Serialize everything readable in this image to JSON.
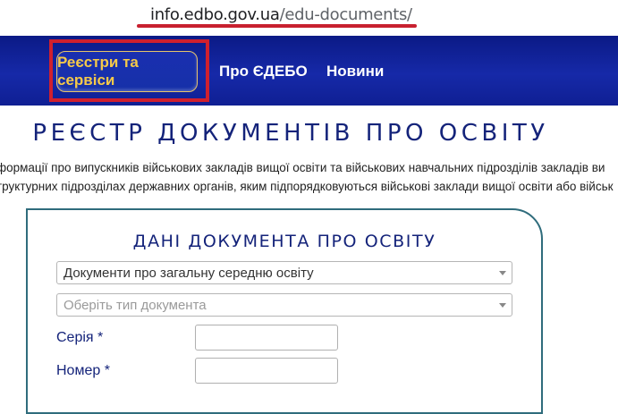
{
  "browser": {
    "url_domain": "info.edbo.gov.ua",
    "url_path": "/edu-documents/"
  },
  "nav": {
    "active_label": "Реєстри та сервіси",
    "items": [
      {
        "label": "Про ЄДЕБО"
      },
      {
        "label": "Новини"
      }
    ]
  },
  "page": {
    "title": "РЕЄСТР ДОКУМЕНТІВ ПРО ОСВІТУ",
    "intro_line1": "формації про випускників військових закладів вищої освіти та військових навчальних підрозділів закладів ви",
    "intro_line2": "труктурних підрозділах державних органів, яким підпорядковуються військові заклади вищої освіти або військ"
  },
  "form": {
    "title": "ДАНІ ДОКУМЕНТА ПРО ОСВІТУ",
    "document_category_value": "Документи про загальну середню освіту",
    "document_type_placeholder": "Оберіть тип документа",
    "series_label": "Серія *",
    "series_value": "",
    "number_label": "Номер *",
    "number_value": ""
  },
  "colors": {
    "nav_bg": "#1629a8",
    "nav_active_text": "#f5c949",
    "highlight_red": "#d0202e",
    "heading_navy": "#14237a",
    "card_border": "#2f6c7c"
  }
}
